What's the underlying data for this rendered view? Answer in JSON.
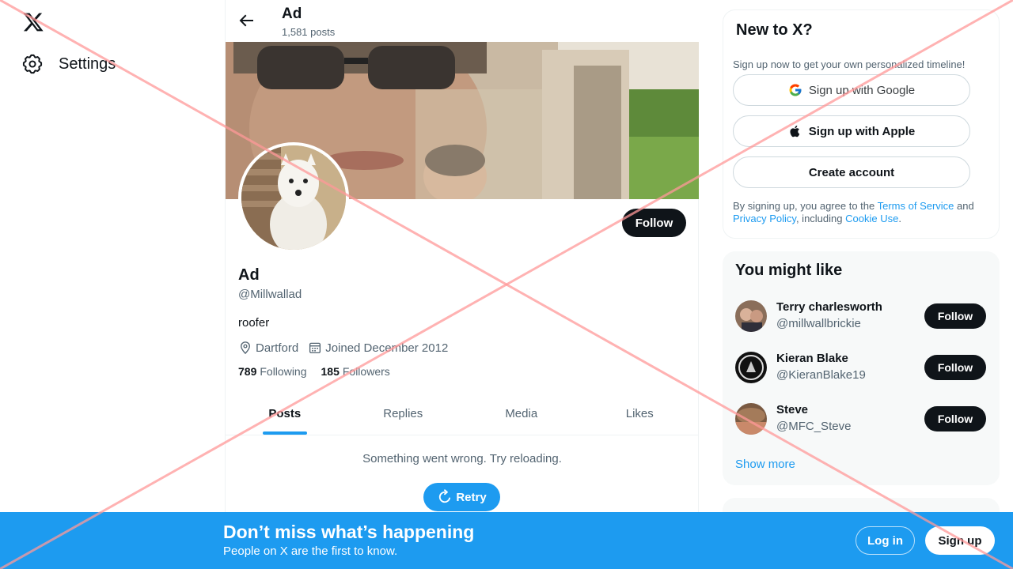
{
  "sidebar": {
    "settings_label": "Settings"
  },
  "header": {
    "name": "Ad",
    "posts_count": "1,581 posts"
  },
  "profile": {
    "name": "Ad",
    "handle": "@Millwallad",
    "bio": "roofer",
    "location": "Dartford",
    "joined": "Joined December 2012",
    "following_count": "789",
    "following_label": "Following",
    "followers_count": "185",
    "followers_label": "Followers",
    "follow_label": "Follow"
  },
  "tabs": [
    {
      "label": "Posts"
    },
    {
      "label": "Replies"
    },
    {
      "label": "Media"
    },
    {
      "label": "Likes"
    }
  ],
  "feed": {
    "error_message": "Something went wrong. Try reloading.",
    "retry_label": "Retry"
  },
  "signup_card": {
    "title": "New to X?",
    "subtitle": "Sign up now to get your own personalized timeline!",
    "google_label": "Sign up with Google",
    "apple_label": "Sign up with Apple",
    "create_label": "Create account",
    "terms_prefix": "By signing up, you agree to the ",
    "terms_link": "Terms of Service",
    "terms_and": " and ",
    "privacy_link": "Privacy Policy",
    "terms_mid": ", including ",
    "cookie_link": "Cookie Use",
    "terms_end": "."
  },
  "suggestions": {
    "title": "You might like",
    "items": [
      {
        "name": "Terry charlesworth",
        "handle": "@millwallbrickie",
        "follow_label": "Follow"
      },
      {
        "name": "Kieran Blake",
        "handle": "@KieranBlake19",
        "follow_label": "Follow"
      },
      {
        "name": "Steve",
        "handle": "@MFC_Steve",
        "follow_label": "Follow"
      }
    ],
    "show_more": "Show more"
  },
  "bottom_bar": {
    "title": "Don’t miss what’s happening",
    "subtitle": "People on X are the first to know.",
    "login_label": "Log in",
    "signup_label": "Sign up"
  },
  "colors": {
    "accent": "#1d9bf0",
    "text_primary": "#0f1419",
    "text_secondary": "#536471",
    "overlay_x": "#ff9999"
  },
  "icons": [
    "x-logo-icon",
    "gear-icon",
    "back-arrow-icon",
    "location-pin-icon",
    "calendar-icon",
    "retry-icon",
    "google-icon",
    "apple-icon"
  ]
}
